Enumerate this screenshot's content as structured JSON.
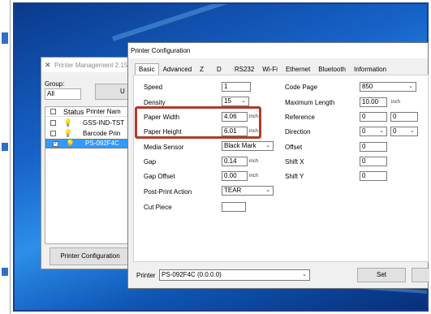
{
  "printer_management": {
    "title": "Printer Management 2.15",
    "group_label": "Group:",
    "group_value": "All",
    "top_button_label": "U",
    "columns": [
      "Status",
      "Printer Nam"
    ],
    "rows": [
      {
        "name": "GSS-IND-TST",
        "checked": false,
        "selected": false
      },
      {
        "name": "Barcode Prin",
        "checked": false,
        "selected": false
      },
      {
        "name": "PS-092F4C",
        "checked": true,
        "selected": true
      }
    ],
    "config_button_label": "Printer Configuration"
  },
  "printer_config": {
    "title": "Printer Configuration",
    "tabs": [
      "Basic",
      "Advanced",
      "Z",
      "D",
      "RS232",
      "Wi-Fi",
      "Ethernet",
      "Bluetooth",
      "Information"
    ],
    "active_tab": "Basic",
    "left": {
      "speed_label": "Speed",
      "speed_value": "1",
      "density_label": "Density",
      "density_value": "15",
      "paper_width_label": "Paper Width",
      "paper_width_value": "4.06",
      "paper_width_unit": "inch",
      "paper_height_label": "Paper Height",
      "paper_height_value": "6.01",
      "paper_height_unit": "inch",
      "media_sensor_label": "Media Sensor",
      "media_sensor_value": "Black Mark",
      "gap_label": "Gap",
      "gap_value": "0.14",
      "gap_unit": "inch",
      "gap_offset_label": "Gap Offset",
      "gap_offset_value": "0.00",
      "gap_offset_unit": "inch",
      "post_print_label": "Post-Print Action",
      "post_print_value": "TEAR",
      "cut_piece_label": "Cut Piece",
      "cut_piece_value": ""
    },
    "right": {
      "code_page_label": "Code Page",
      "code_page_value": "850",
      "max_length_label": "Maximum Length",
      "max_length_value": "10.00",
      "max_length_unit": "inch",
      "reference_label": "Reference",
      "reference_x": "0",
      "reference_y": "0",
      "direction_label": "Direction",
      "direction_a": "0",
      "direction_b": "0",
      "offset_label": "Offset",
      "offset_value": "0",
      "shift_x_label": "Shift X",
      "shift_x_value": "0",
      "shift_y_label": "Shift Y",
      "shift_y_value": "0"
    },
    "printer_label": "Printer",
    "printer_value": "PS-092F4C (0.0.0.0)",
    "set_button_label": "Set",
    "highlight_color": "#b23a2a"
  }
}
